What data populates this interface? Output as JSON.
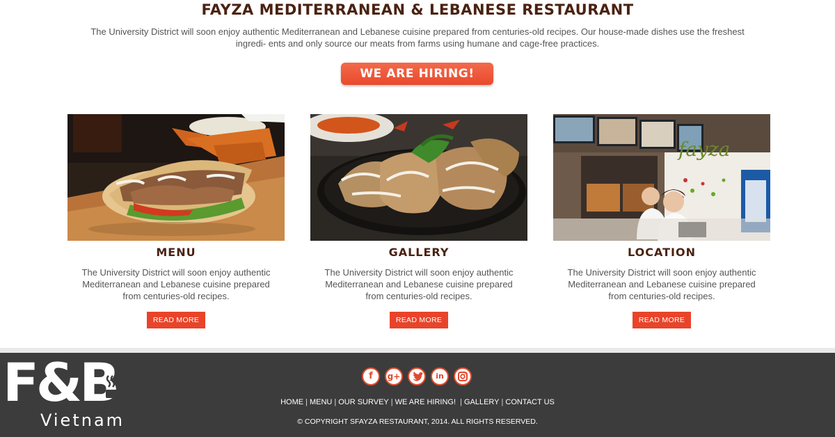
{
  "hero": {
    "title": "FAYZA MEDITERRANEAN & LEBANESE RESTAURANT",
    "description": "The University District will soon enjoy authentic Mediterranean and Lebanese cuisine prepared from centuries-old recipes.  Our house-made dishes use the freshest ingredi- ents and only source our meats from farms using humane and cage-free practices.",
    "cta_label": "WE ARE HIRING!"
  },
  "cards": [
    {
      "title": "MENU",
      "description": "The University District will soon enjoy authentic Mediterranean and Lebanese cuisine prepared from centuries-old recipes.",
      "button_label": "READ MORE",
      "image": "shawarma-pita-photo"
    },
    {
      "title": "GALLERY",
      "description": "The University District will soon enjoy authentic Mediterranean and Lebanese cuisine prepared from centuries-old recipes.",
      "button_label": "READ MORE",
      "image": "shawarma-plate-photo"
    },
    {
      "title": "LOCATION",
      "description": "The University District will soon enjoy authentic Mediterranean and Lebanese cuisine prepared from centuries-old recipes.",
      "button_label": "READ MORE",
      "image": "restaurant-counter-photo"
    }
  ],
  "footer": {
    "socials": [
      {
        "icon": "facebook-icon",
        "glyph": "f"
      },
      {
        "icon": "google-plus-icon",
        "glyph": "g+"
      },
      {
        "icon": "twitter-icon",
        "glyph": "t"
      },
      {
        "icon": "linkedin-icon",
        "glyph": "in"
      },
      {
        "icon": "instagram-icon",
        "glyph": "◎"
      }
    ],
    "nav": [
      "HOME",
      "MENU",
      "OUR SURVEY",
      "WE ARE HIRING!",
      "GALLERY",
      "CONTACT US"
    ],
    "copyright": "© COPYRIGHT SFAYZA RESTAURANT, 2014. ALL RIGHTS RESERVED."
  },
  "watermark": {
    "brand": "F&B",
    "subtitle": "Vietnam"
  },
  "colors": {
    "title_brown": "#4a2212",
    "accent_red": "#e8442a",
    "footer_bg": "#3c3c3c"
  }
}
